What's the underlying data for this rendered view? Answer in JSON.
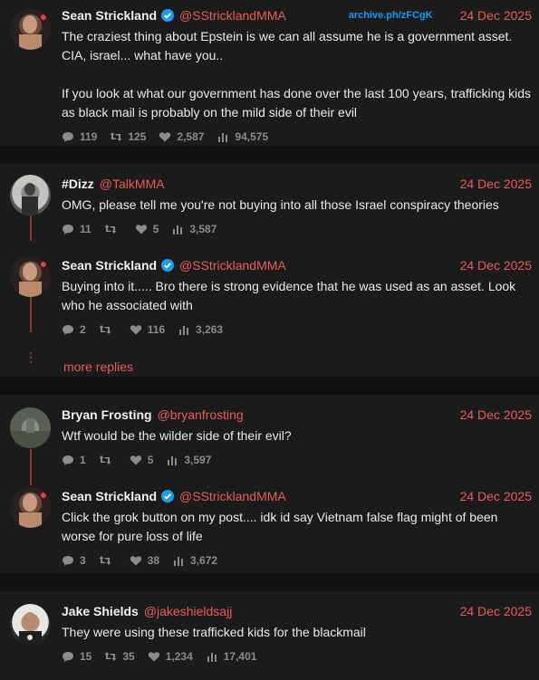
{
  "archive_label": "archive.ph/zFCgK",
  "threads": [
    {
      "tweets": [
        {
          "name": "Sean Strickland",
          "verified": true,
          "handle": "@SStricklandMMA",
          "date": "24 Dec 2025",
          "text": "The craziest thing about Epstein is we can all assume he is a government asset. CIA, israel... what have you..\n\nIf you look at what our government has done over the last 100 years, trafficking kids as black mail is probably on the mild side of their evil",
          "replies": "119",
          "retweets": "125",
          "likes": "2,587",
          "views": "94,575"
        }
      ]
    },
    {
      "tweets": [
        {
          "name": "#Dizz",
          "verified": false,
          "handle": "@TalkMMA",
          "date": "24 Dec 2025",
          "text": "OMG, please tell me you're not buying into all those Israel conspiracy theories",
          "replies": "11",
          "retweets": "",
          "likes": "5",
          "views": "3,587"
        },
        {
          "name": "Sean Strickland",
          "verified": true,
          "handle": "@SStricklandMMA",
          "date": "24 Dec 2025",
          "text": "Buying into it..... Bro there is strong evidence that he was used as an asset. Look who he associated with",
          "replies": "2",
          "retweets": "",
          "likes": "116",
          "views": "3,263"
        }
      ],
      "more_replies": "more replies"
    },
    {
      "tweets": [
        {
          "name": "Bryan Frosting",
          "verified": false,
          "handle": "@bryanfrosting",
          "date": "24 Dec 2025",
          "text": "Wtf would be the wilder side of their evil?",
          "replies": "1",
          "retweets": "",
          "likes": "5",
          "views": "3,597"
        },
        {
          "name": "Sean Strickland",
          "verified": true,
          "handle": "@SStricklandMMA",
          "date": "24 Dec 2025",
          "text": "Click the grok button on my post.... idk id say Vietnam false flag might of been worse for pure loss of life",
          "replies": "3",
          "retweets": "",
          "likes": "38",
          "views": "3,672"
        }
      ]
    },
    {
      "tweets": [
        {
          "name": "Jake Shields",
          "verified": false,
          "handle": "@jakeshieldsajj",
          "date": "24 Dec 2025",
          "text": "They were using these trafficked kids for the blackmail",
          "replies": "15",
          "retweets": "35",
          "likes": "1,234",
          "views": "17,401"
        }
      ]
    }
  ],
  "colors": {
    "accent": "#ea5d55",
    "verified": "#1d9bf0",
    "background": "#1b1b1c",
    "thread_line": "#8b3a38"
  }
}
